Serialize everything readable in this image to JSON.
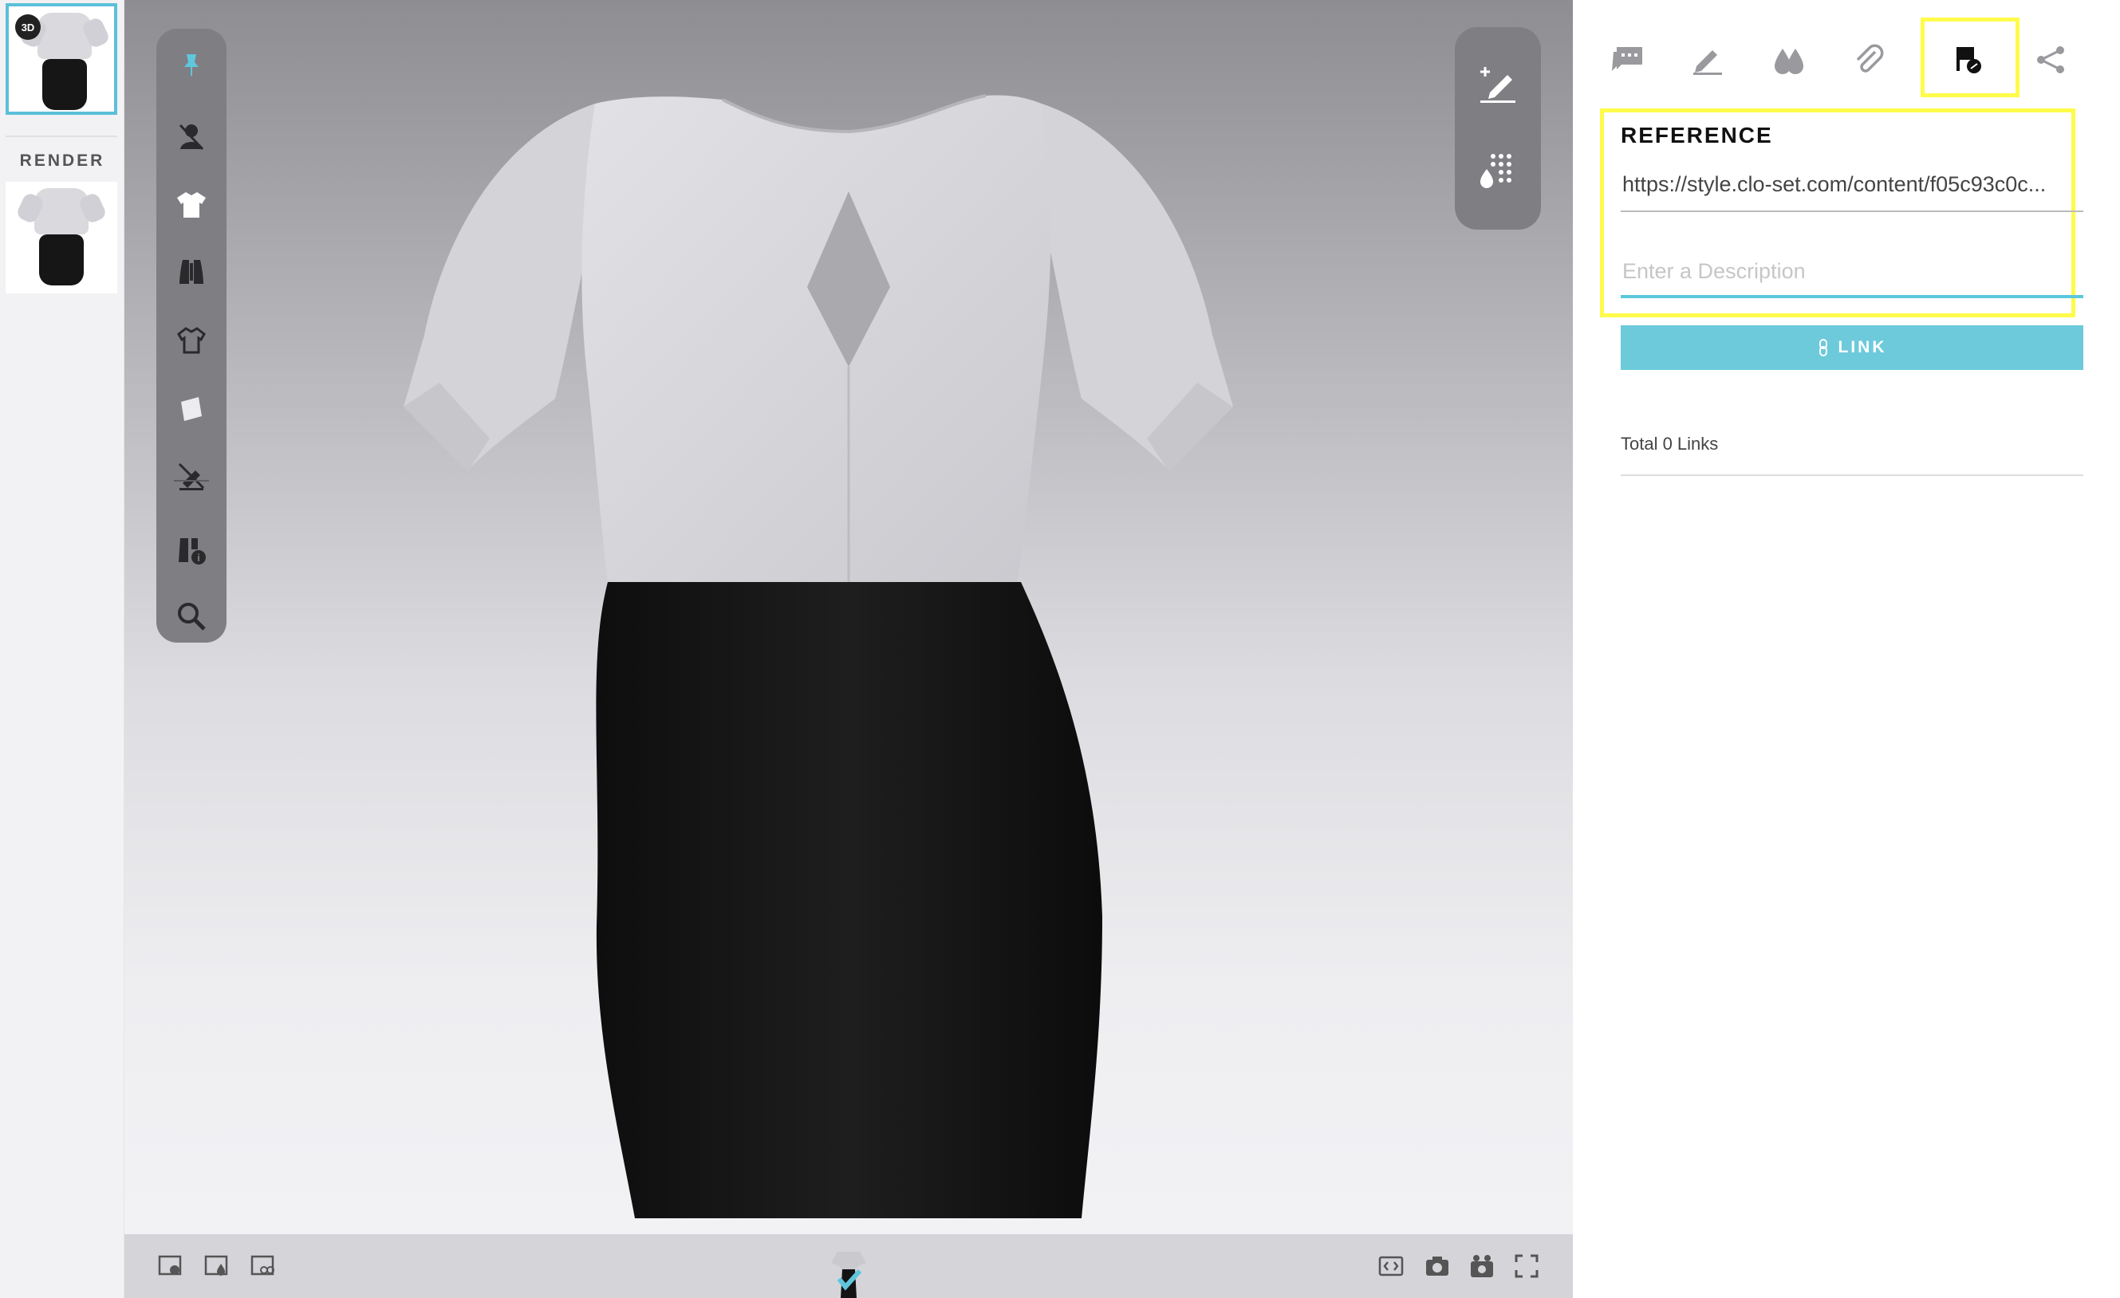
{
  "left_rail": {
    "badge_3d": "3D",
    "render_label": "RENDER"
  },
  "viewer": {
    "left_tools": [
      "pin-icon",
      "avatar-hide-icon",
      "garment-icon",
      "fabric-texture-icon",
      "garment-detail-icon",
      "sheet-icon",
      "hide-tool-icon",
      "garment-info-icon",
      "zoom-icon"
    ],
    "right_tools": [
      "add-annotation-icon",
      "colorway-grid-icon"
    ],
    "bottom_left_tools": [
      "scene-settings-icon",
      "render-settings-icon",
      "avatar-settings-icon"
    ],
    "bottom_right_tools": [
      "embed-code-icon",
      "camera-icon",
      "snapshot-icon",
      "fullscreen-icon"
    ],
    "colors": {
      "top": "#d6d6da",
      "skirt": "#141414"
    }
  },
  "panel": {
    "tabs": [
      "comments-icon",
      "edit-icon",
      "colorway-drops-icon",
      "attachment-icon",
      "reference-link-icon",
      "share-icon"
    ],
    "active_tab": "reference-link-icon",
    "reference": {
      "title": "REFERENCE",
      "url_value": "https://style.clo-set.com/content/f05c93c0c...",
      "description_placeholder": "Enter a Description",
      "link_button": "LINK"
    },
    "total_links": "Total 0 Links"
  },
  "accent_colors": {
    "highlight": "#fffb4a",
    "primary": "#6ccadb"
  }
}
